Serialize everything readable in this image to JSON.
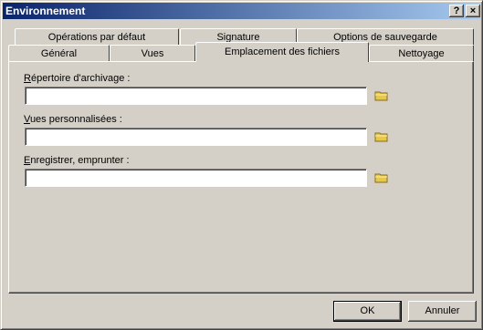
{
  "window": {
    "title": "Environnement",
    "help_label": "?",
    "close_label": "×"
  },
  "tabs_back": [
    {
      "label": "Opérations par défaut"
    },
    {
      "label": "Signature"
    },
    {
      "label": "Options de sauvegarde"
    }
  ],
  "tabs_front": [
    {
      "label": "Général"
    },
    {
      "label": "Vues"
    },
    {
      "label": "Emplacement des fichiers",
      "active": true
    },
    {
      "label": "Nettoyage"
    }
  ],
  "fields": [
    {
      "label_first": "R",
      "label_rest": "épertoire d'archivage :",
      "value": "",
      "icon": "folder-icon"
    },
    {
      "label_first": "V",
      "label_rest": "ues personnalisées :",
      "value": "",
      "icon": "folder-icon"
    },
    {
      "label_first": "E",
      "label_rest": "nregistrer, emprunter :",
      "value": "",
      "icon": "folder-icon"
    }
  ],
  "buttons": {
    "ok": "OK",
    "cancel": "Annuler"
  },
  "colors": {
    "title_gradient_start": "#0a246a",
    "title_gradient_end": "#a6caf0",
    "folder": "#e6c84a"
  }
}
